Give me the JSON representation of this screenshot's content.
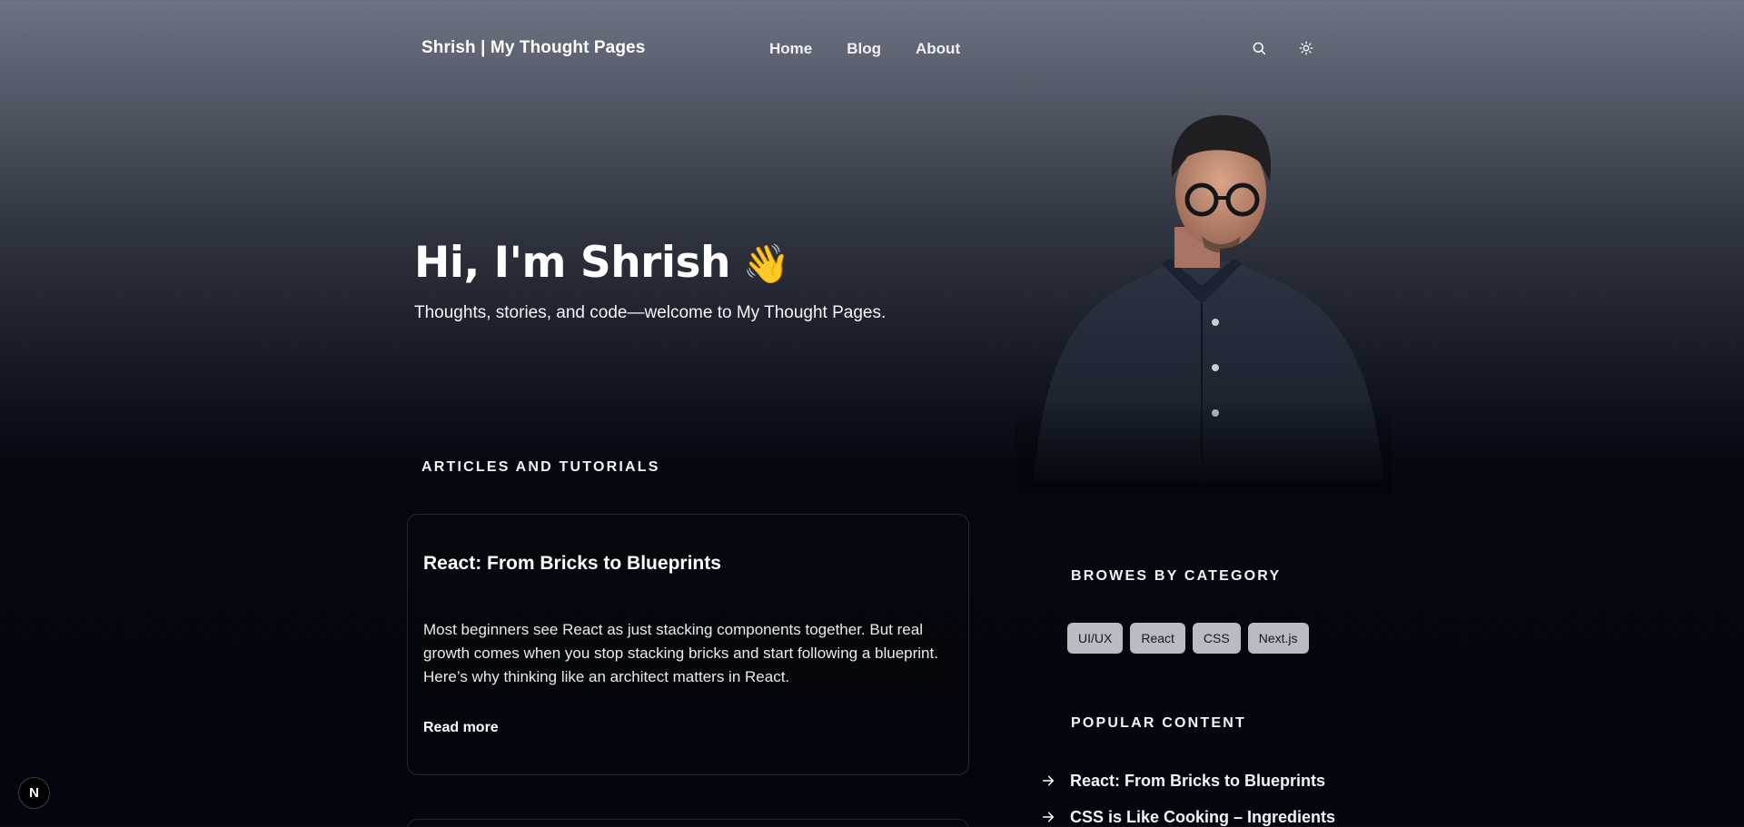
{
  "nav": {
    "brand": "Shrish | My Thought Pages",
    "links": [
      "Home",
      "Blog",
      "About"
    ],
    "icons": [
      "search-icon",
      "theme-toggle-icon"
    ]
  },
  "hero": {
    "title": "Hi, I'm Shrish",
    "emoji": "👋",
    "subtitle": "Thoughts, stories, and code—welcome to My Thought Pages."
  },
  "articles": {
    "heading": "ARTICLES AND TUTORIALS",
    "items": [
      {
        "title": "React: From Bricks to Blueprints",
        "excerpt": "Most beginners see React as just stacking components together. But real growth comes when you stop stacking bricks and start following a blueprint. Here’s why thinking like an architect matters in React.",
        "read_more": "Read more"
      }
    ]
  },
  "categories": {
    "heading": "BROWES BY CATEGORY",
    "tags": [
      "UI/UX",
      "React",
      "CSS",
      "Next.js"
    ]
  },
  "popular": {
    "heading": "POPULAR CONTENT",
    "items": [
      "React: From Bricks to Blueprints",
      "CSS is Like Cooking – Ingredients"
    ]
  },
  "badge": {
    "label": "N"
  },
  "colors": {
    "background_top": "#6e7482",
    "background_bottom": "#03060d",
    "chip": "#b8bcc3",
    "card_border": "#22262f"
  }
}
